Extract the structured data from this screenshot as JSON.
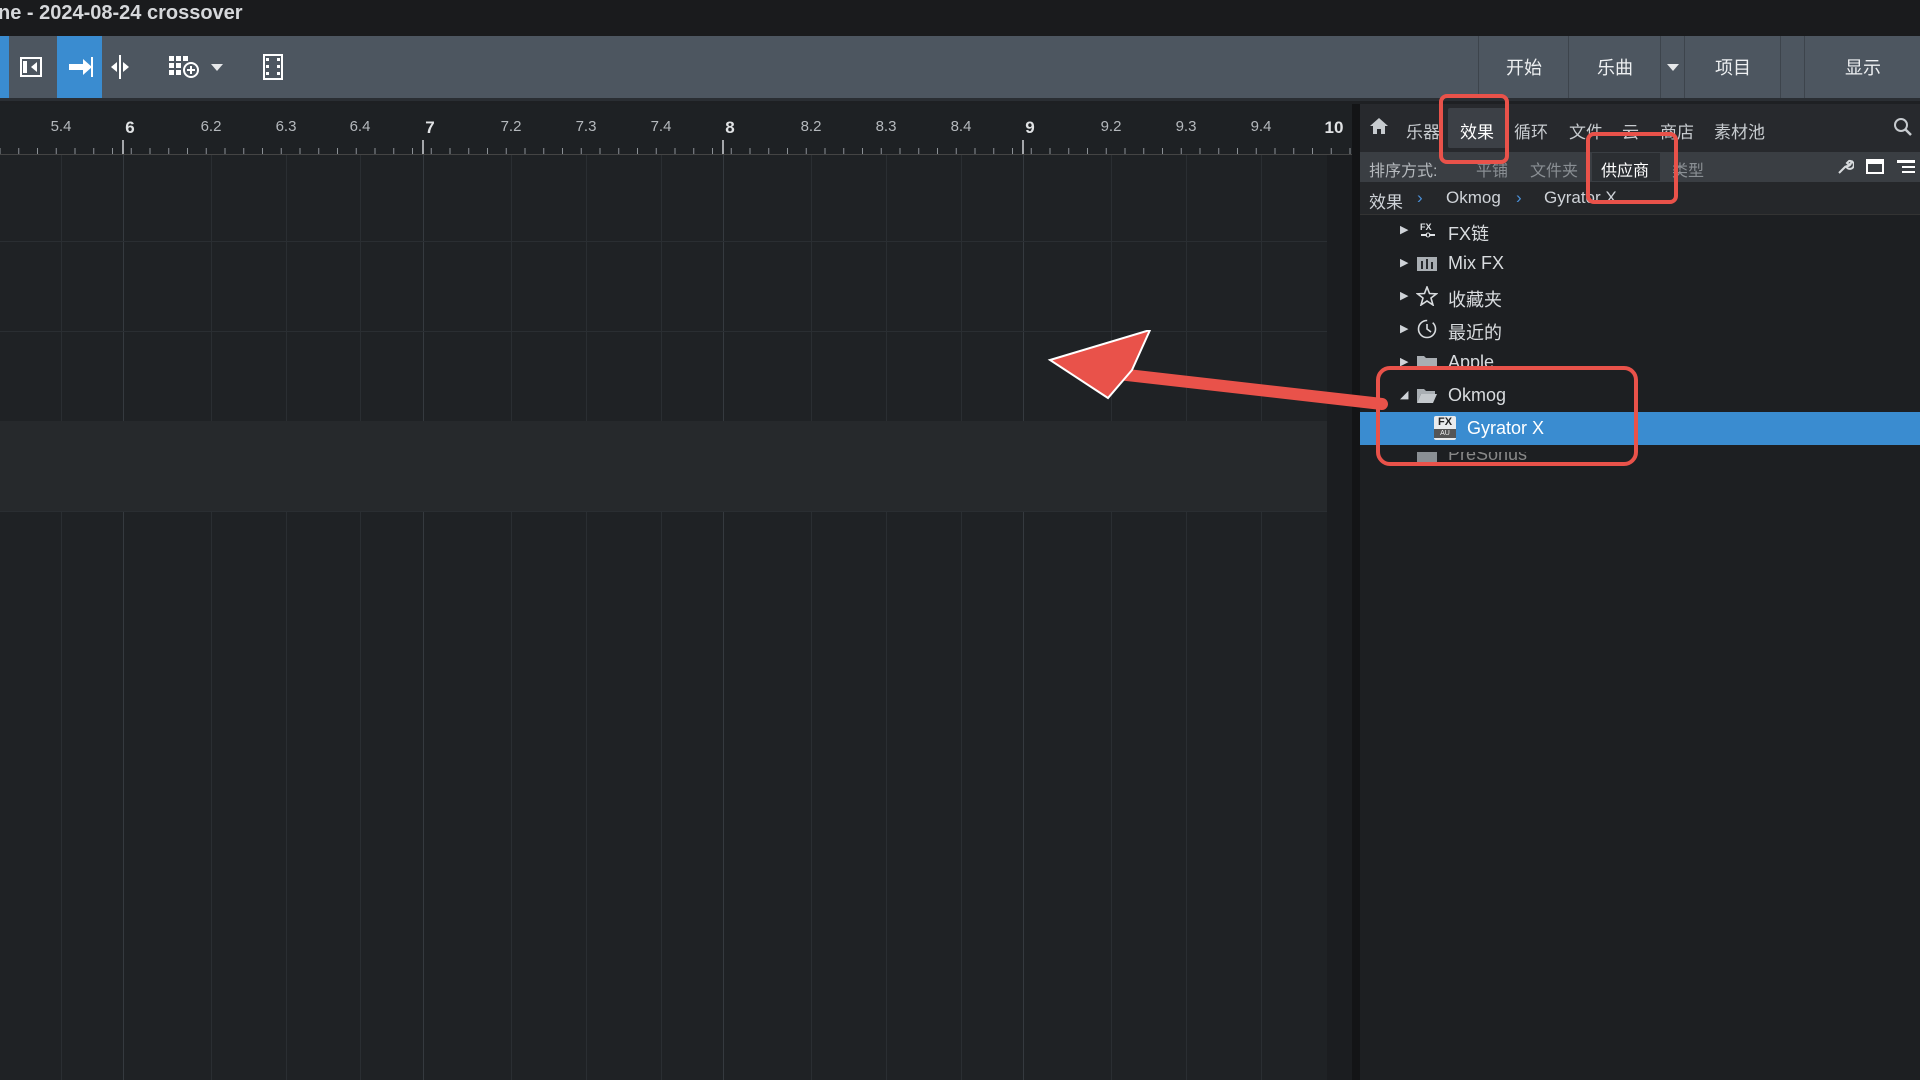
{
  "window": {
    "title": "ne - 2024-08-24 crossover"
  },
  "toolbar": {
    "nav": [
      "开始",
      "乐曲",
      "项目",
      "显示"
    ]
  },
  "ruler": {
    "labels": [
      "5.4",
      "6",
      "6.2",
      "6.3",
      "6.4",
      "7",
      "7.2",
      "7.3",
      "7.4",
      "8",
      "8.2",
      "8.3",
      "8.4",
      "9",
      "9.2",
      "9.3",
      "9.4",
      "10"
    ]
  },
  "browser": {
    "tabs": [
      "乐器",
      "效果",
      "循环",
      "文件",
      "云",
      "商店",
      "素材池"
    ],
    "sort": {
      "label": "排序方式:",
      "options": [
        "平铺",
        "文件夹",
        "供应商",
        "类型"
      ],
      "selected": "供应商"
    },
    "breadcrumb": [
      "效果",
      "Okmog",
      "Gyrator X"
    ],
    "tree": [
      {
        "label": "FX链",
        "icon": "fx-chain-icon"
      },
      {
        "label": "Mix FX",
        "icon": "mix-fx-icon"
      },
      {
        "label": "收藏夹",
        "icon": "star-icon"
      },
      {
        "label": "最近的",
        "icon": "clock-icon"
      },
      {
        "label": "Apple",
        "icon": "folder-icon"
      },
      {
        "label": "Okmog",
        "icon": "folder-open-icon"
      },
      {
        "label": "Gyrator X",
        "icon": "fx-au-icon",
        "badge_top": "FX",
        "badge_bottom": "AU"
      },
      {
        "label": "PreSonus",
        "icon": "mixer-icon"
      }
    ]
  },
  "colors": {
    "accent": "#3a8cd0",
    "highlight": "#e9524a"
  }
}
